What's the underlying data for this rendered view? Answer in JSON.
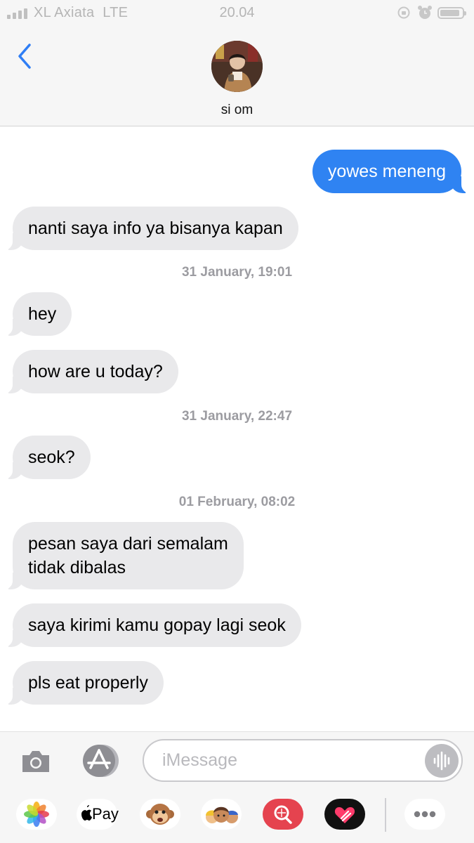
{
  "status_bar": {
    "carrier": "XL Axiata",
    "network": "LTE",
    "time": "20.04",
    "battery_level": 0.92
  },
  "header": {
    "contact_name": "si om",
    "icons": [
      "back-chevron-icon",
      "contact-avatar"
    ]
  },
  "messages": [
    {
      "type": "sent",
      "text": "yowes meneng"
    },
    {
      "type": "received",
      "text": "nanti saya info ya bisanya kapan"
    },
    {
      "type": "timestamp",
      "text": "31 January, 19:01"
    },
    {
      "type": "received",
      "text": "hey"
    },
    {
      "type": "received",
      "text": "how are u today?"
    },
    {
      "type": "timestamp",
      "text": "31 January, 22:47"
    },
    {
      "type": "received",
      "text": "seok?"
    },
    {
      "type": "timestamp",
      "text": "01 February, 08:02"
    },
    {
      "type": "received",
      "text": "pesan saya dari semalam\ntidak dibalas"
    },
    {
      "type": "received",
      "text": "saya kirimi kamu gopay lagi seok"
    },
    {
      "type": "received",
      "text": "pls eat properly"
    }
  ],
  "input_bar": {
    "placeholder": "iMessage",
    "value": "",
    "icons": [
      "camera-icon",
      "app-store-icon",
      "audio-waveform-icon"
    ]
  },
  "app_drawer": {
    "items": [
      {
        "name": "photos-icon",
        "label": ""
      },
      {
        "name": "apple-pay-icon",
        "label": "Pay"
      },
      {
        "name": "animoji-monkey-icon",
        "label": ""
      },
      {
        "name": "memoji-icon",
        "label": ""
      },
      {
        "name": "image-search-icon",
        "label": ""
      },
      {
        "name": "digital-touch-icon",
        "label": ""
      },
      {
        "name": "more-icon",
        "label": ""
      }
    ]
  },
  "colors": {
    "sent_bubble": "#2f83f2",
    "received_bubble": "#e9e9eb",
    "link_blue": "#2f7ef5",
    "timestamp_gray": "#9c9ca1"
  }
}
